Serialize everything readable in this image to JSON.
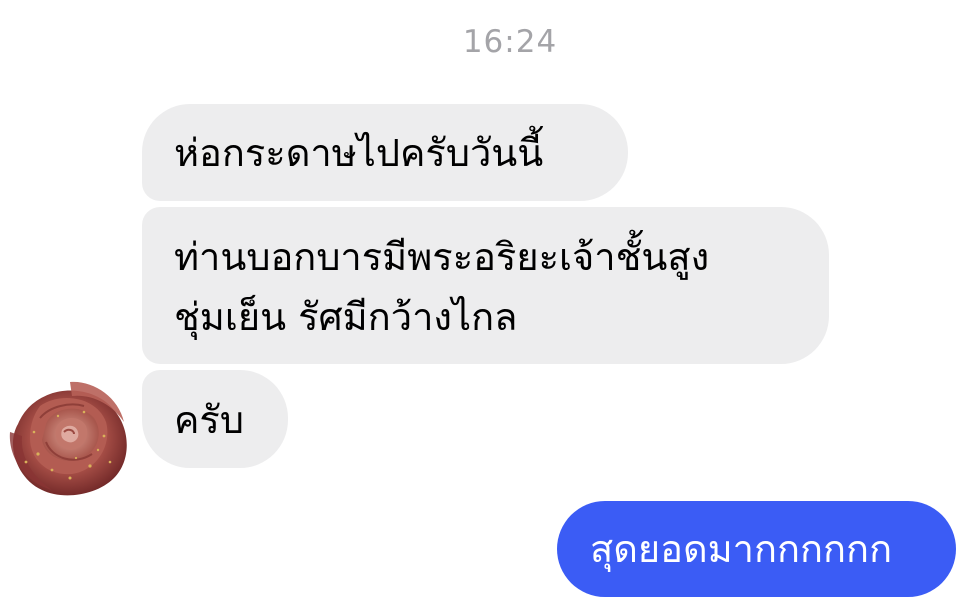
{
  "chat": {
    "timestamp": "16:24",
    "messages": [
      {
        "sender": "contact",
        "lines": [
          "ห่อกระดาษไปครับวันนี้"
        ]
      },
      {
        "sender": "contact",
        "lines": [
          "ท่านบอกบารมีพระอริยะเจ้าชั้นสูง",
          "ชุ่มเย็น รัศมีกว้างไกล"
        ]
      },
      {
        "sender": "contact",
        "lines": [
          "ครับ"
        ]
      },
      {
        "sender": "me",
        "lines": [
          "สุดยอดมากกกกกก"
        ]
      }
    ],
    "avatar_icon": "rose-avatar-icon"
  },
  "colors": {
    "incoming_bubble": "#ededee",
    "outgoing_bubble": "#3b5cf5",
    "timestamp_text": "#a4a4a8"
  }
}
